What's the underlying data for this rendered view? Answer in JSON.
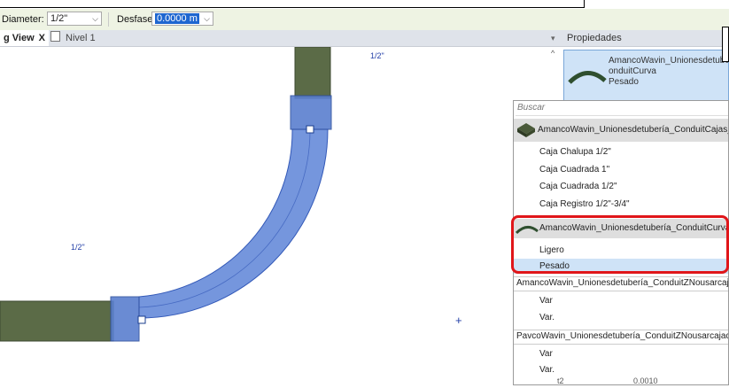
{
  "options_bar": {
    "diameter_label": "Diameter:",
    "diameter_value": "1/2\"",
    "offset_label": "Desfase:",
    "offset_value": "0.0000 m"
  },
  "tabs": [
    {
      "label": "g View",
      "close": "X"
    },
    {
      "label": "Nivel 1"
    }
  ],
  "canvas": {
    "label_top": "1/2\"",
    "label_left": "1/2\"",
    "plus": "+"
  },
  "properties": {
    "title": "Propiedades",
    "filter_icon": "▾",
    "caret": "^",
    "type_line1": "AmancoWavin_Unionesdetubería_C",
    "type_line2": "onduitCurva",
    "type_line3": "Pesado"
  },
  "dropdown": {
    "search_placeholder": "Buscar",
    "families": [
      {
        "name": "AmancoWavin_Unionesdetubería_ConduitCajas_Codo",
        "types": [
          "Caja Chalupa 1/2\"",
          "Caja Cuadrada 1\"",
          "Caja Cuadrada 1/2\"",
          "Caja Registro 1/2\"-3/4\""
        ]
      },
      {
        "name": "AmancoWavin_Unionesdetubería_ConduitCurva",
        "types": [
          "Ligero",
          "Pesado"
        ]
      },
      {
        "name": "AmancoWavin_Unionesdetubería_ConduitZNousarcajachalupa",
        "types": [
          "Var",
          "Var."
        ]
      },
      {
        "name": "PavcoWavin_Unionesdetubería_ConduitZNousarcajachalupa",
        "types": [
          "Var",
          "Var."
        ]
      }
    ],
    "selected": "Pesado"
  },
  "bottom_row": {
    "name": "t2",
    "value": "0.0010"
  },
  "colors": {
    "pipe_green": "#5b6b47",
    "fitting_blue": "#6f8fd8",
    "selection_red": "#e0161a"
  }
}
